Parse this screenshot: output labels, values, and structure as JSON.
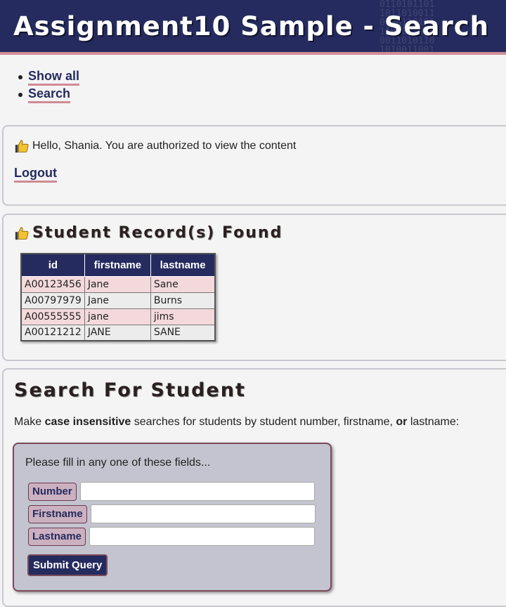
{
  "header": {
    "title": "Assignment10 Sample - Search",
    "binary_bg": "0110101101\n1011010011\n0100110101\n1101011010\n0011010110\n1010011001"
  },
  "nav": {
    "items": [
      {
        "label": "Show all"
      },
      {
        "label": "Search"
      }
    ]
  },
  "auth": {
    "message": "Hello, Shania. You are authorized to view the content",
    "logout_label": "Logout"
  },
  "results": {
    "heading": "Student Record(s) Found",
    "columns": [
      "id",
      "firstname",
      "lastname"
    ],
    "rows": [
      [
        "A00123456",
        "Jane",
        "Sane"
      ],
      [
        "A00797979",
        "Jane",
        "Burns"
      ],
      [
        "A00555555",
        "jane",
        "jims"
      ],
      [
        "A00121212",
        "JANE",
        "SANE"
      ]
    ]
  },
  "search": {
    "heading": "Search For Student",
    "desc": {
      "p1": "Make ",
      "b1": "case insensitive",
      "p2": " searches for students by student number, firstname, ",
      "b2": "or",
      "p3": " lastname:"
    },
    "hint": "Please fill in any one of these fields...",
    "fields": [
      {
        "label": "Number",
        "value": ""
      },
      {
        "label": "Firstname",
        "value": ""
      },
      {
        "label": "Lastname",
        "value": ""
      }
    ],
    "submit_label": "Submit Query"
  },
  "colors": {
    "header_bg": "#252b5e",
    "accent_underline": "#d08a95",
    "row_pink": "#f4d9dc",
    "row_gray": "#ececec",
    "form_bg": "#c4c4d0"
  },
  "icons": {
    "status": "thumbs-up-icon"
  }
}
